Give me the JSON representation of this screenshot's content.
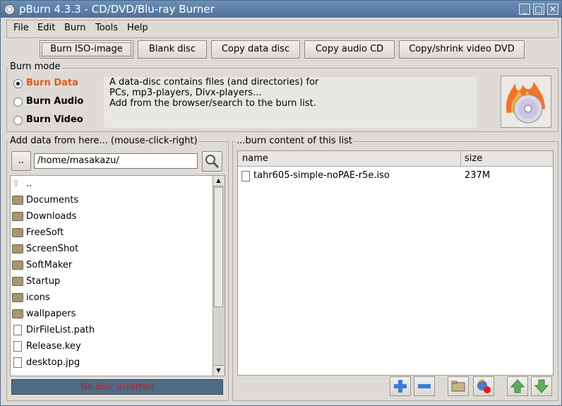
{
  "window": {
    "title": "pBurn 4.3.3 - CD/DVD/Blu-ray Burner",
    "minimize": "_",
    "maximize": "□",
    "close": "✕"
  },
  "menu": [
    "File",
    "Edit",
    "Burn",
    "Tools",
    "Help"
  ],
  "toolbar": {
    "burn_iso": "Burn ISO-image",
    "blank_disc": "Blank disc",
    "copy_data_disc": "Copy data disc",
    "copy_audio_cd": "Copy audio CD",
    "copy_shrink_dvd": "Copy/shrink video DVD"
  },
  "burn_mode": {
    "label": "Burn mode",
    "options": [
      "Burn Data",
      "Burn Audio",
      "Burn Video"
    ],
    "selected": "Burn Data",
    "description": [
      "A data-disc contains files (and directories) for",
      "PCs, mp3-players, Divx-players...",
      "Add from the browser/search to the burn list."
    ]
  },
  "browser": {
    "label": "Add data from here... (mouse-click-right)",
    "up_button": "..",
    "path": "/home/masakazu/",
    "items": [
      {
        "name": "..",
        "icon": "up-arrow-icon"
      },
      {
        "name": "Documents",
        "icon": "folder-icon"
      },
      {
        "name": "Downloads",
        "icon": "folder-icon"
      },
      {
        "name": "FreeSoft",
        "icon": "folder-icon"
      },
      {
        "name": "ScreenShot",
        "icon": "folder-icon"
      },
      {
        "name": "SoftMaker",
        "icon": "folder-icon"
      },
      {
        "name": "Startup",
        "icon": "folder-icon"
      },
      {
        "name": "icons",
        "icon": "folder-icon"
      },
      {
        "name": "wallpapers",
        "icon": "folder-icon"
      },
      {
        "name": "DirFileList.path",
        "icon": "file-icon"
      },
      {
        "name": "Release.key",
        "icon": "file-icon"
      },
      {
        "name": "desktop.jpg",
        "icon": "file-icon"
      }
    ],
    "status": "No disc inserted"
  },
  "burn_list": {
    "label": "...burn content of this list",
    "columns": [
      "name",
      "size"
    ],
    "rows": [
      {
        "name": "tahr605-simple-noPAE-r5e.iso",
        "size": "237M"
      }
    ]
  },
  "colors": {
    "accent": "#e05a1a",
    "status_bg": "#4e6b86",
    "status_text": "#c02020"
  }
}
